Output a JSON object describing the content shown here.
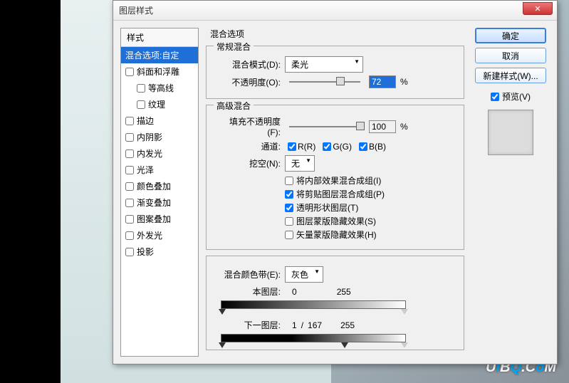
{
  "dialog": {
    "title": "图层样式",
    "close": "✕"
  },
  "styles": {
    "header": "样式",
    "items": [
      {
        "label": "混合选项:自定",
        "checked": null,
        "selected": true
      },
      {
        "label": "斜面和浮雕",
        "checked": false
      },
      {
        "label": "等高线",
        "checked": false,
        "indent": true
      },
      {
        "label": "纹理",
        "checked": false,
        "indent": true
      },
      {
        "label": "描边",
        "checked": false
      },
      {
        "label": "内阴影",
        "checked": false
      },
      {
        "label": "内发光",
        "checked": false
      },
      {
        "label": "光泽",
        "checked": false
      },
      {
        "label": "颜色叠加",
        "checked": false
      },
      {
        "label": "渐变叠加",
        "checked": false
      },
      {
        "label": "图案叠加",
        "checked": false
      },
      {
        "label": "外发光",
        "checked": false
      },
      {
        "label": "投影",
        "checked": false
      }
    ]
  },
  "blending": {
    "title": "混合选项",
    "general": {
      "legend": "常规混合",
      "mode_label": "混合模式(D):",
      "mode_value": "柔光",
      "opacity_label": "不透明度(O):",
      "opacity_value": "72",
      "pct": "%"
    },
    "advanced": {
      "legend": "高级混合",
      "fill_label": "填充不透明度(F):",
      "fill_value": "100",
      "pct": "%",
      "channels_label": "通道:",
      "channels": [
        {
          "label": "R(R)",
          "checked": true
        },
        {
          "label": "G(G)",
          "checked": true
        },
        {
          "label": "B(B)",
          "checked": true
        }
      ],
      "knockout_label": "挖空(N):",
      "knockout_value": "无",
      "checks": [
        {
          "label": "将内部效果混合成组(I)",
          "checked": false
        },
        {
          "label": "将剪贴图层混合成组(P)",
          "checked": true
        },
        {
          "label": "透明形状图层(T)",
          "checked": true
        },
        {
          "label": "图层蒙版隐藏效果(S)",
          "checked": false
        },
        {
          "label": "矢量蒙版隐藏效果(H)",
          "checked": false
        }
      ]
    },
    "blendif": {
      "label": "混合颜色带(E):",
      "value": "灰色",
      "this_layer": "本图层:",
      "this_vals": [
        "0",
        "255"
      ],
      "under_layer": "下一图层:",
      "under_vals": [
        "1",
        "/",
        "167",
        "255"
      ]
    }
  },
  "buttons": {
    "ok": "确定",
    "cancel": "取消",
    "new_style": "新建样式(W)...",
    "preview": "预览(V)"
  },
  "watermark": "UiBQ.CoM"
}
